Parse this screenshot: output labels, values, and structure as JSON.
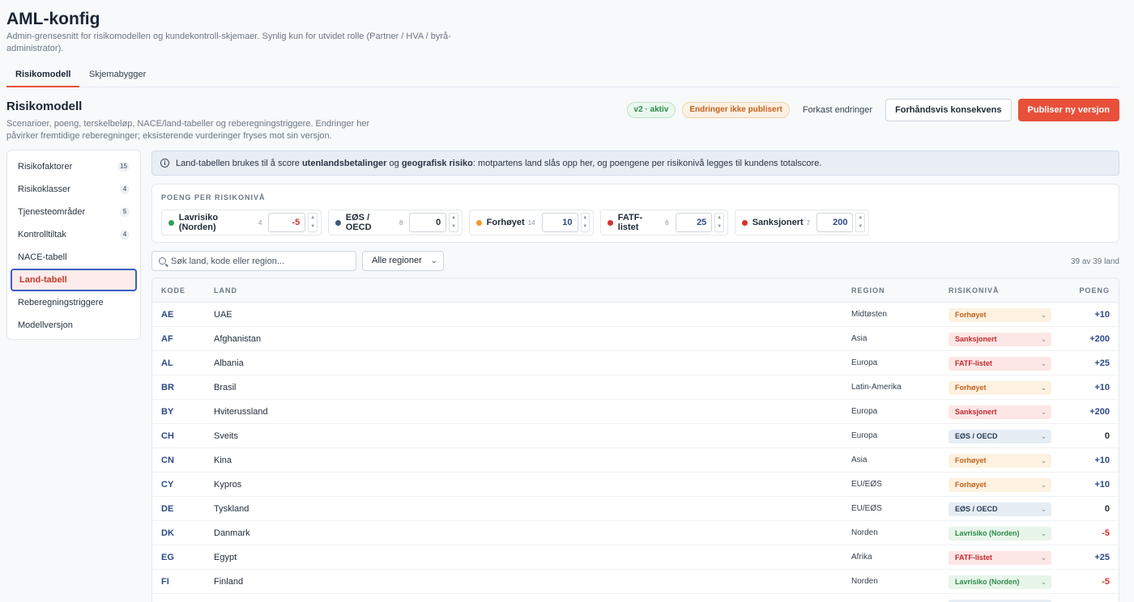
{
  "page": {
    "title": "AML-konfig",
    "subtitle": "Admin-grensesnitt for risikomodellen og kundekontroll-skjemaer. Synlig kun for utvidet rolle (Partner / HVA / byrå-administrator)."
  },
  "tabs": [
    {
      "label": "Risikomodell"
    },
    {
      "label": "Skjemabygger"
    }
  ],
  "section": {
    "title": "Risikomodell",
    "subtitle": "Scenarioer, poeng, terskelbeløp, NACE/land-tabeller og reberegningstriggere. Endringer her påvirker fremtidige reberegninger; eksisterende vurderinger fryses mot sin versjon."
  },
  "header_actions": {
    "version_badge": "v2 · aktiv",
    "unpublished_badge": "Endringer ikke publisert",
    "discard_label": "Forkast endringer",
    "preview_label": "Forhåndsvis konsekvens",
    "publish_label": "Publiser ny versjon"
  },
  "sidebar": {
    "items": [
      {
        "label": "Risikofaktorer",
        "badge": "15"
      },
      {
        "label": "Risikoklasser",
        "badge": "4"
      },
      {
        "label": "Tjenesteområder",
        "badge": "5"
      },
      {
        "label": "Kontrolltiltak",
        "badge": "4"
      },
      {
        "label": "NACE-tabell",
        "badge": ""
      },
      {
        "label": "Land-tabell",
        "badge": ""
      },
      {
        "label": "Reberegningstriggere",
        "badge": ""
      },
      {
        "label": "Modellversjon",
        "badge": ""
      }
    ]
  },
  "info": {
    "pre": "Land-tabellen brukes til å score ",
    "bold1": "utenlandsbetalinger",
    "mid": " og ",
    "bold2": "geografisk risiko",
    "post": ": motpartens land slås opp her, og poengene per risikonivå legges til kundens totalscore."
  },
  "score_card": {
    "label": "POENG PER RISIKONIVÅ",
    "levels": [
      {
        "name": "Lavrisiko (Norden)",
        "count": "4",
        "value": "-5",
        "dot": "#2f9e5a",
        "value_color": "#d6332b"
      },
      {
        "name": "EØS / OECD",
        "count": "8",
        "value": "0",
        "dot": "#3c5a7a",
        "value_color": "#1f2a37"
      },
      {
        "name": "Forhøyet",
        "count": "14",
        "value": "10",
        "dot": "#ef9a2e",
        "value_color": "#2b4a8a"
      },
      {
        "name": "FATF-listet",
        "count": "6",
        "value": "25",
        "dot": "#d6332b",
        "value_color": "#2b4a8a"
      },
      {
        "name": "Sanksjonert",
        "count": "7",
        "value": "200",
        "dot": "#d6332b",
        "value_color": "#2b4a8a"
      }
    ]
  },
  "filters": {
    "search_placeholder": "Søk land, kode eller region...",
    "region_select": "Alle regioner",
    "count_text": "39 av 39 land"
  },
  "table": {
    "headers": {
      "code": "KODE",
      "land": "LAND",
      "region": "REGION",
      "level": "RISIKONIVÅ",
      "points": "POENG"
    },
    "rows": [
      {
        "code": "AE",
        "land": "UAE",
        "region": "Midtøsten",
        "level": "Forhøyet",
        "points": "+10"
      },
      {
        "code": "AF",
        "land": "Afghanistan",
        "region": "Asia",
        "level": "Sanksjonert",
        "points": "+200"
      },
      {
        "code": "AL",
        "land": "Albania",
        "region": "Europa",
        "level": "FATF-listet",
        "points": "+25"
      },
      {
        "code": "BR",
        "land": "Brasil",
        "region": "Latin-Amerika",
        "level": "Forhøyet",
        "points": "+10"
      },
      {
        "code": "BY",
        "land": "Hviterussland",
        "region": "Europa",
        "level": "Sanksjonert",
        "points": "+200"
      },
      {
        "code": "CH",
        "land": "Sveits",
        "region": "Europa",
        "level": "EØS / OECD",
        "points": "0"
      },
      {
        "code": "CN",
        "land": "Kina",
        "region": "Asia",
        "level": "Forhøyet",
        "points": "+10"
      },
      {
        "code": "CY",
        "land": "Kypros",
        "region": "EU/EØS",
        "level": "Forhøyet",
        "points": "+10"
      },
      {
        "code": "DE",
        "land": "Tyskland",
        "region": "EU/EØS",
        "level": "EØS / OECD",
        "points": "0"
      },
      {
        "code": "DK",
        "land": "Danmark",
        "region": "Norden",
        "level": "Lavrisiko (Norden)",
        "points": "-5"
      },
      {
        "code": "EG",
        "land": "Egypt",
        "region": "Afrika",
        "level": "FATF-listet",
        "points": "+25"
      },
      {
        "code": "FI",
        "land": "Finland",
        "region": "Norden",
        "level": "Lavrisiko (Norden)",
        "points": "-5"
      },
      {
        "code": "",
        "land": "",
        "region": "",
        "level": "EØS / OECD",
        "points": ""
      }
    ]
  },
  "level_styles": {
    "Forhøyet": {
      "bg": "#fdf1e0",
      "fg": "#c4621c"
    },
    "Sanksjonert": {
      "bg": "#fde6e6",
      "fg": "#c0282b"
    },
    "FATF-listet": {
      "bg": "#fde6e6",
      "fg": "#c0282b"
    },
    "EØS / OECD": {
      "bg": "#e6edf5",
      "fg": "#2a3b55"
    },
    "Lavrisiko (Norden)": {
      "bg": "#e7f5ea",
      "fg": "#2f8a4a"
    }
  }
}
